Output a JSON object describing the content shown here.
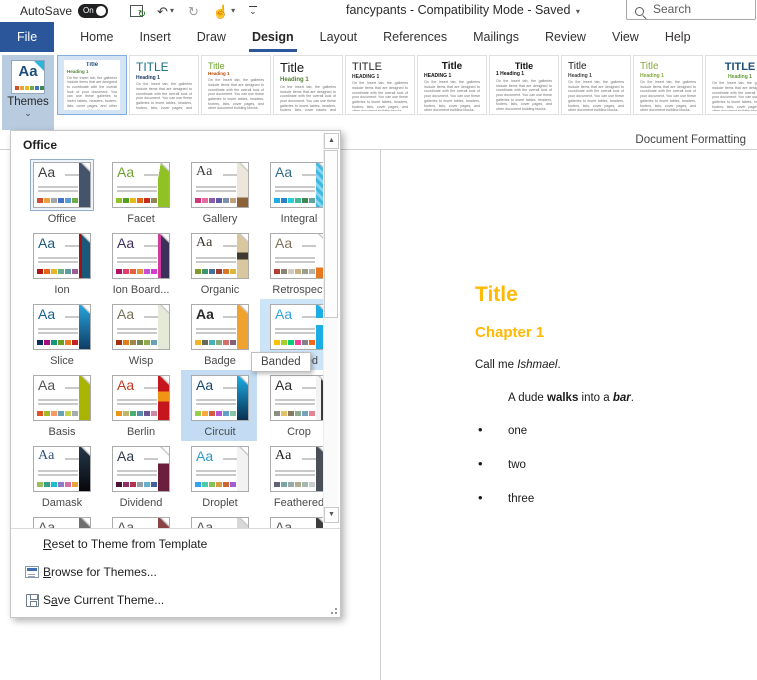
{
  "titlebar": {
    "autosave_label": "AutoSave",
    "autosave_state": "On",
    "title": "fancypants  -  Compatibility Mode  -  Saved",
    "search_placeholder": "Search"
  },
  "tabs": [
    {
      "label": "File",
      "file": true
    },
    {
      "label": "Home"
    },
    {
      "label": "Insert"
    },
    {
      "label": "Draw"
    },
    {
      "label": "Design",
      "active": true
    },
    {
      "label": "Layout"
    },
    {
      "label": "References"
    },
    {
      "label": "Mailings"
    },
    {
      "label": "Review"
    },
    {
      "label": "View"
    },
    {
      "label": "Help"
    }
  ],
  "ribbon": {
    "themes_button_label": "Themes",
    "group_label": "Document Formatting",
    "body_filler": "On the Insert tab, the galleries include items that are designed to coordinate with the overall look of your document. You can use these galleries to insert tables, headers, footers, lists, cover pages, and other document building blocks.",
    "style_sets": [
      {
        "title": "Title",
        "tc": "#1F4E79",
        "ts": 6,
        "tb": true,
        "tctr": true,
        "heading": "Heading 1",
        "hc": "#538135",
        "hs": 4.5,
        "selected": true
      },
      {
        "title": "TITLE",
        "tc": "#16707E",
        "ts": 12,
        "tb": false,
        "heading": "Heading 1",
        "hc": "#1F3864",
        "hs": 5
      },
      {
        "title": "Title",
        "tc": "#6FA22E",
        "ts": 9,
        "tb": false,
        "heading": "Heading 1",
        "hc": "#B94700",
        "hs": 4.5
      },
      {
        "title": "Title",
        "tc": "#1A1A1A",
        "ts": 13,
        "tb": false,
        "heading": "Heading 1",
        "hc": "#538135",
        "hs": 6
      },
      {
        "title": "TITLE",
        "tc": "#262626",
        "ts": 11,
        "tb": false,
        "heading": "HEADING 1",
        "hc": "#262626",
        "hs": 5
      },
      {
        "title": "Title",
        "tc": "#111111",
        "ts": 10,
        "tb": true,
        "tctr": true,
        "heading": "HEADING 1",
        "hc": "#111111",
        "hs": 5
      },
      {
        "title": "Title",
        "tc": "#111111",
        "ts": 9,
        "tb": true,
        "tctr": true,
        "heading": "1  Heading 1",
        "hc": "#111111",
        "hs": 5
      },
      {
        "title": "Title",
        "tc": "#222222",
        "ts": 10,
        "tb": false,
        "heading": "Heading 1",
        "hc": "#444444",
        "hs": 5
      },
      {
        "title": "Title",
        "tc": "#87A93F",
        "ts": 10,
        "tb": false,
        "heading": "Heading 1",
        "hc": "#87A93F",
        "hs": 5
      },
      {
        "title": "TITLE",
        "tc": "#1F4E79",
        "ts": 11,
        "tb": true,
        "tctr": true,
        "heading": "Heading 1",
        "hc": "#629B33",
        "hs": 5,
        "hctr": true
      }
    ]
  },
  "dropdown": {
    "section_label": "Office",
    "tooltip": "Banded",
    "themes": [
      {
        "name": "Office",
        "aa": "#404040",
        "dots": [
          "#D34E2A",
          "#E8A33D",
          "#A5A5A5",
          "#4472C4",
          "#5B9BD5",
          "#70AD47"
        ],
        "band": "#44546A",
        "state": "hl-border"
      },
      {
        "name": "Facet",
        "aa": "#6FA22E",
        "dots": [
          "#90C226",
          "#54A021",
          "#E6B91E",
          "#E76618",
          "#C42F1A",
          "#918655"
        ],
        "band": "linear-gradient(100deg,#ffffff 15%,#90C226 15%)"
      },
      {
        "name": "Gallery",
        "aa": "#404040",
        "serif": true,
        "dots": [
          "#D13478",
          "#E46C9F",
          "#8F5BA6",
          "#5B5EA6",
          "#7C91A9",
          "#C0A078"
        ],
        "band": "linear-gradient(180deg,#EDE6DA 0 78%,#8C6239 78%)"
      },
      {
        "name": "Integral",
        "aa": "#356B85",
        "dots": [
          "#1CADE4",
          "#2683C6",
          "#27CED7",
          "#42BA97",
          "#3E8853",
          "#62A39F"
        ],
        "band": "repeating-linear-gradient(45deg,#3FB9E4 0 3px,#8ED4EE 3px 6px)"
      },
      {
        "name": "Ion",
        "aa": "#1B587C",
        "dots": [
          "#B01513",
          "#EA6312",
          "#E6B729",
          "#6AAC90",
          "#5F9C9D",
          "#9E5E9B"
        ],
        "band": "linear-gradient(90deg,#9E1313 0 25%,#1B587C 25%)"
      },
      {
        "name": "Ion Board...",
        "aa": "#3B3059",
        "dots": [
          "#B31166",
          "#E33D6F",
          "#E45F3C",
          "#E9943A",
          "#C54FD5",
          "#D63CD0"
        ],
        "band": "linear-gradient(90deg,#D13C9C 0 25%,#3B3059 25%)"
      },
      {
        "name": "Organic",
        "aa": "#3F3A2F",
        "serif": true,
        "dots": [
          "#83992A",
          "#3C9770",
          "#44709D",
          "#A23C33",
          "#D97828",
          "#DEB340"
        ],
        "band": "linear-gradient(180deg,#D9C89E 0 42%,#3F3A2F 42% 58%,#D9C89E 58%)"
      },
      {
        "name": "Retrospect",
        "aa": "#80735D",
        "dots": [
          "#B13F31",
          "#8C8473",
          "#D1CBBF",
          "#C7B07B",
          "#9A9E8C",
          "#B5B2A6"
        ],
        "band": "linear-gradient(180deg,#FFFFFF 0 76%,#E8781F 76%)"
      },
      {
        "name": "Slice",
        "aa": "#146194",
        "dots": [
          "#052F61",
          "#A50E82",
          "#14967C",
          "#6A9E1F",
          "#E87D1E",
          "#C62324"
        ],
        "band": "linear-gradient(180deg,#27A3DD,#0E3D64)"
      },
      {
        "name": "Wisp",
        "aa": "#766F54",
        "dots": [
          "#A53010",
          "#DE7E18",
          "#9F8351",
          "#728653",
          "#92AA4C",
          "#6AA2B5"
        ],
        "band": "#E4E9D8"
      },
      {
        "name": "Badge",
        "aa": "#2A2A2A",
        "heavy": true,
        "dots": [
          "#F8B323",
          "#656A59",
          "#46B2B5",
          "#8CAA7E",
          "#D36F68",
          "#826276"
        ],
        "band": "#F0A22E"
      },
      {
        "name": "Banded",
        "aa": "#35A3DC",
        "dots": [
          "#FFC000",
          "#A5D028",
          "#08CC78",
          "#F24099",
          "#828288",
          "#F56617"
        ],
        "band": "linear-gradient(180deg,#1CADE4 0 30%,#FFFFFF 30% 46%,#1CADE4 46%)",
        "state": "hl-fill"
      },
      {
        "name": "Basis",
        "aa": "#545454",
        "dots": [
          "#DF5327",
          "#A6B727",
          "#FE9666",
          "#6AA2B5",
          "#C5D14F",
          "#A5ACAF"
        ],
        "band": "#A8B400"
      },
      {
        "name": "Berlin",
        "aa": "#C0391E",
        "dots": [
          "#F09415",
          "#C1B56B",
          "#4BAF73",
          "#588DA8",
          "#705394",
          "#CF87A2"
        ],
        "band": "linear-gradient(180deg,#C4161C 0 35%,#F09415 35% 58%,#C4161C 58%)"
      },
      {
        "name": "Circuit",
        "aa": "#134770",
        "dots": [
          "#9ACD4C",
          "#FAA93A",
          "#D35940",
          "#B258D3",
          "#63A0CC",
          "#8AC4A7"
        ],
        "band": "linear-gradient(180deg,#1CADE4,#0A2F51)",
        "state": "hl-sel"
      },
      {
        "name": "Crop",
        "aa": "#2E2E2E",
        "dots": [
          "#8C8D86",
          "#E6C069",
          "#897B61",
          "#8DAB8E",
          "#77A2BB",
          "#E28394"
        ],
        "band": "linear-gradient(90deg,#F3F3F3 0 45%,#3A3A3A 45% 62%,#CFCFCF 62%)"
      },
      {
        "name": "Damask",
        "aa": "#30537A",
        "serif": true,
        "dots": [
          "#9EBC5C",
          "#32A18A",
          "#1FBDD1",
          "#8F7BC6",
          "#D66FA8",
          "#E8A33D"
        ],
        "band": "linear-gradient(180deg,#25384C,#06080B)"
      },
      {
        "name": "Dividend",
        "aa": "#303A49",
        "dots": [
          "#4D1434",
          "#903163",
          "#B2324B",
          "#969FA7",
          "#66B1CE",
          "#40619D"
        ],
        "band": "linear-gradient(180deg,#FFFFFF 0 38%,#6B1F3C 38%)"
      },
      {
        "name": "Droplet",
        "aa": "#2E9BD1",
        "dots": [
          "#2FA3EE",
          "#4BCAAD",
          "#86C157",
          "#D99C3F",
          "#CE6633",
          "#A35DD1"
        ],
        "band": "#F2F2F2"
      },
      {
        "name": "Feathered",
        "aa": "#1F1F1F",
        "serif": true,
        "dots": [
          "#606372",
          "#79A8A4",
          "#9BA8AA",
          "#B2AD8F",
          "#A2B8B0",
          "#C7CDD1"
        ],
        "band": "#4A505A"
      },
      {
        "name": "",
        "aa": "#555555",
        "dots": [],
        "band": "#6E6E6E"
      },
      {
        "name": "",
        "aa": "#555555",
        "dots": [],
        "band": "#8A4444"
      },
      {
        "name": "",
        "aa": "#555555",
        "dots": [],
        "band": "#D8D8D8"
      },
      {
        "name": "",
        "aa": "#555555",
        "dots": [],
        "band": "#3C3C3C"
      }
    ],
    "menu_items": [
      {
        "label": "Reset to Theme from Template",
        "accel": 0,
        "icon": ""
      },
      {
        "label": "Browse for Themes...",
        "accel": 0,
        "icon": "browse"
      },
      {
        "label": "Save Current Theme...",
        "accel": 1,
        "icon": "save"
      }
    ]
  },
  "document": {
    "title": "Title",
    "heading": "Chapter 1",
    "accent_color": "#FFB900",
    "para1": [
      {
        "t": "Call me "
      },
      {
        "t": "Ishmael",
        "i": true
      },
      {
        "t": "."
      }
    ],
    "para2": [
      {
        "t": "A dude "
      },
      {
        "t": "walks",
        "b": true
      },
      {
        "t": " into a "
      },
      {
        "t": "bar",
        "b": true,
        "i": true
      },
      {
        "t": "."
      }
    ],
    "bullets": [
      "one",
      "two",
      "three"
    ]
  }
}
